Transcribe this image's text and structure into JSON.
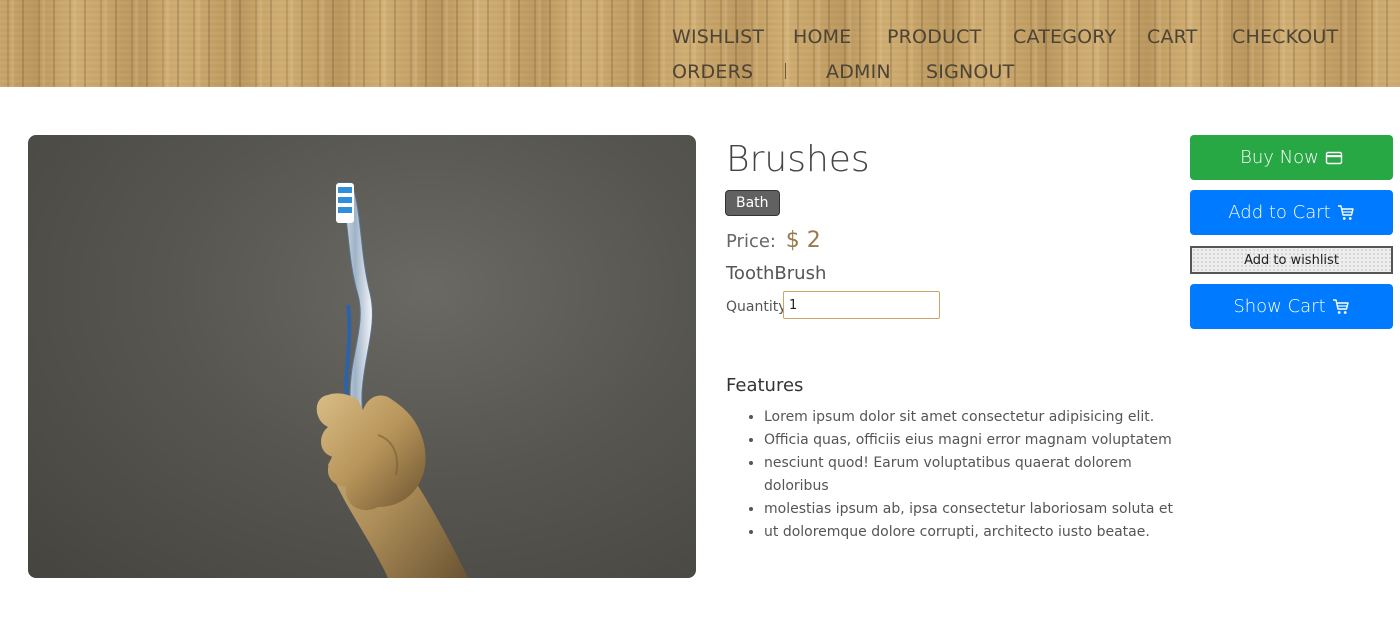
{
  "nav": {
    "wishlist": "WISHLIST",
    "home": "HOME",
    "product": "PRODUCT",
    "category": "CATEGORY",
    "cart": "CART",
    "checkout": "CHECKOUT",
    "orders": "ORDERS",
    "separator": "|",
    "admin": "ADMIN",
    "signout": "SIGNOUT"
  },
  "product": {
    "title": "Brushes",
    "category_badge": "Bath",
    "price_label": "Price:",
    "price_value": "$ 2",
    "name": "ToothBrush",
    "quantity_label": "Quantity",
    "quantity_value": "1"
  },
  "features": {
    "title": "Features",
    "items": [
      "Lorem ipsum dolor sit amet consectetur adipisicing elit.",
      "Officia quas, officiis eius magni error magnam voluptatem",
      "nesciunt quod! Earum voluptatibus quaerat dolorem doloribus",
      "molestias ipsum ab, ipsa consectetur laboriosam soluta et",
      "ut doloremque dolore corrupti, architecto iusto beatae."
    ]
  },
  "actions": {
    "buy_now": "Buy Now",
    "buy_now_icon": "credit-card-icon",
    "add_to_cart": "Add to Cart",
    "add_to_cart_icon": "cart-icon",
    "add_to_wishlist": "Add to wishlist",
    "show_cart": "Show Cart",
    "show_cart_icon": "cart-icon"
  },
  "colors": {
    "header_wood": "#c9a66a",
    "buy_green": "#28a745",
    "cart_blue": "#007bff",
    "badge_gray": "#616161",
    "price_gold": "#9a7a4d"
  }
}
